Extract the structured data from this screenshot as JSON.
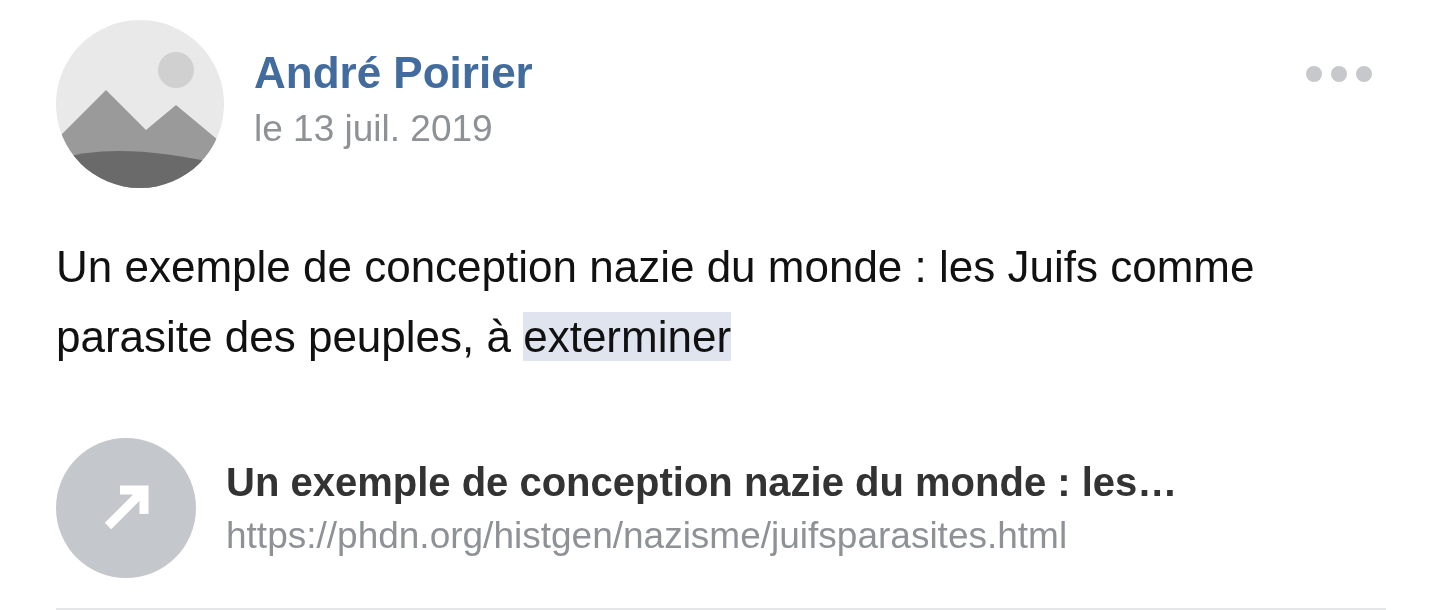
{
  "post": {
    "author": "André Poirier",
    "date": "le 13 juil. 2019",
    "body": [
      {
        "text": "Un exemple de conception nazie du monde : les Juifs comme parasite des peuples, à ",
        "highlighted": false
      },
      {
        "text": "exterminer",
        "highlighted": true
      }
    ],
    "link": {
      "title": "Un exemple de conception nazie du monde : les…",
      "url": "https://phdn.org/histgen/nazisme/juifsparasites.html"
    }
  }
}
